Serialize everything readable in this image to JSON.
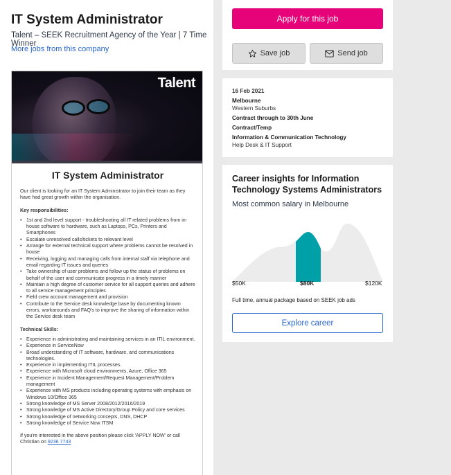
{
  "job": {
    "title": "IT System Administrator",
    "company": "Talent – SEEK Recruitment Agency of the Year | 7 Time Winner",
    "more_jobs_link": "More jobs from this company"
  },
  "ad": {
    "brand_logo_text": "Talent",
    "title": "IT System Administrator",
    "intro": "Our client is looking for an IT System Administrator to join their team as they have had great growth within the organisation.",
    "responsibilities_heading": "Key responsibilities:",
    "responsibilities": [
      "1st and 2nd level support - troubleshooting all IT related problems from in-house software to hardware, such as Laptops, PCs, Printers and Smartphones",
      "Escalate unresolved calls/tickets to relevant level",
      "Arrange for external technical support where problems cannot be resolved in house",
      "Receiving, logging and managing calls from internal staff via telephone and email regarding IT issues and queries",
      "Take ownership of user problems and follow up the status of problems on behalf of the user and communicate progress in a timely manner",
      "Maintain a high degree of customer service for all support queries and adhere to all service management principles",
      "Field crew account management and provision",
      "Contribute to the Service desk knowledge base by documenting known errors, workarounds and FAQ's to improve the sharing of information within the Service desk team"
    ],
    "skills_heading": "Technical Skills:",
    "skills": [
      "Experience in administrating and maintaining services in an ITIL environment.",
      "Experience in ServiceNow",
      "Broad understanding of IT software, hardware, and communications technologies.",
      "Experience in implementing ITIL processes.",
      "Experience with Microsoft cloud environments, Azure, Office 365",
      "Experience in Incident Management/Request Management/Problem management",
      "Experience with MS products including operating systems with emphasis on Windows 10/Office 365",
      "Strong knowledge of MS Server 2008/2012/2016/2019",
      "Strong knowledge of MS Active Directory/Group Policy and core services",
      "Strong knowledge of networking concepts, DNS, DHCP",
      "Strong knowledge of Service Now ITSM"
    ],
    "outro": "If you're interested in the above position please click 'APPLY NOW' or call Christian on ",
    "phone": "9236 7743"
  },
  "actions": {
    "apply_label": "Apply for this job",
    "save_label": "Save job",
    "send_label": "Send job"
  },
  "meta": {
    "date": "16 Feb 2021",
    "location": "Melbourne",
    "area": "Western Suburbs",
    "contract_note": "Contract through to 30th June",
    "work_type": "Contract/Temp",
    "classification": "Information & Communication Technology",
    "sub_classification": "Help Desk & IT Support"
  },
  "career": {
    "title": "Career insights for Information Technology Systems Administrators",
    "salary_subtitle": "Most common salary in Melbourne",
    "tick_low": "$50K",
    "tick_mid": "$80K",
    "tick_high": "$120K",
    "note": "Full time, annual package based on SEEK job ads",
    "explore_label": "Explore career"
  },
  "colors": {
    "apply": "#e60278",
    "link": "#2765cf",
    "highlight": "#00a0a8",
    "distribution": "#ececec"
  }
}
